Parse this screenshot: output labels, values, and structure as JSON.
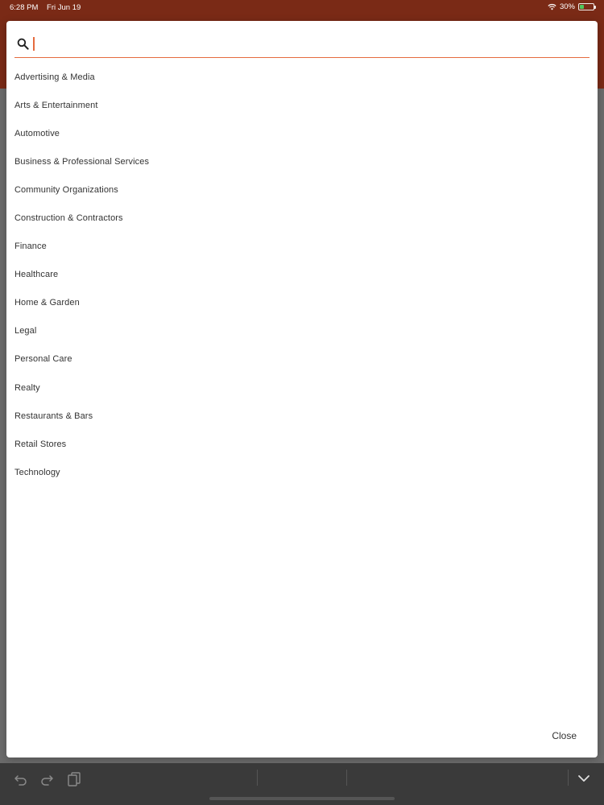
{
  "status_bar": {
    "time": "6:28 PM",
    "date": "Fri Jun 19",
    "battery": "30%",
    "battery_level": 0.3
  },
  "modal": {
    "search": {
      "value": "",
      "placeholder": ""
    },
    "items": [
      "Advertising & Media",
      "Arts & Entertainment",
      "Automotive",
      "Business & Professional Services",
      "Community Organizations",
      "Construction & Contractors",
      "Finance",
      "Healthcare",
      "Home & Garden",
      "Legal",
      "Personal Care",
      "Realty",
      "Restaurants & Bars",
      "Retail Stores",
      "Technology"
    ],
    "close_label": "Close"
  },
  "colors": {
    "app_bar": "#7a2a16",
    "accent": "#e56b3e",
    "toolbar": "#3a3a3a"
  },
  "icons": {
    "search": "search-icon",
    "undo": "undo-icon",
    "redo": "redo-icon",
    "paste": "paste-icon",
    "dismiss_keyboard": "chevron-down-icon",
    "wifi": "wifi-icon",
    "battery": "battery-icon"
  }
}
